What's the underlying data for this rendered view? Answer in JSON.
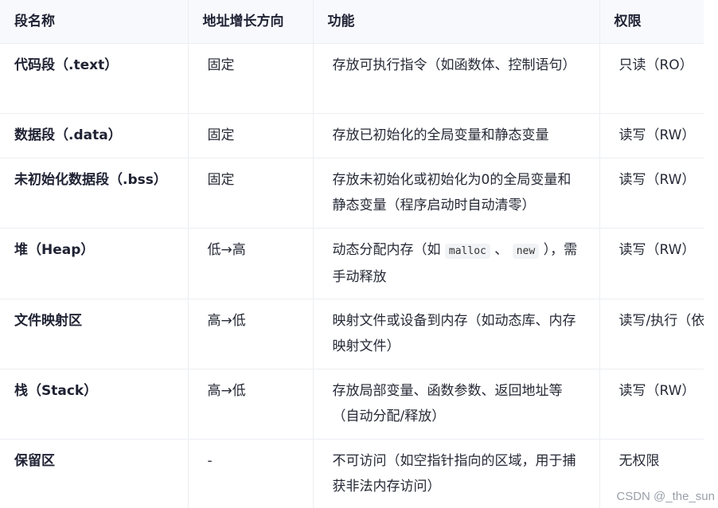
{
  "table": {
    "headers": [
      "段名称",
      "地址增长方向",
      "功能",
      "权限"
    ],
    "rows": [
      {
        "segment": "代码段（.text）",
        "direction": "固定",
        "function_text": "存放可执行指令（如函数体、控制语句）",
        "permission": "只读（RO）"
      },
      {
        "segment": "数据段（.data）",
        "direction": "固定",
        "function_text": "存放已初始化的全局变量和静态变量",
        "permission": "读写（RW）"
      },
      {
        "segment": "未初始化数据段（.bss）",
        "direction": "固定",
        "function_text": "存放未初始化或初始化为0的全局变量和静态变量（程序启动时自动清零）",
        "permission": "读写（RW）"
      },
      {
        "segment": "堆（Heap）",
        "direction": "低→高",
        "function_prefix": "动态分配内存（如 ",
        "function_code1": "malloc",
        "function_sep": " 、 ",
        "function_code2": "new",
        "function_suffix": " ），需手动释放",
        "permission": "读写（RW）"
      },
      {
        "segment": "文件映射区",
        "direction": "高→低",
        "function_text": "映射文件或设备到内存（如动态库、内存映射文件）",
        "permission": "读写/执行（依"
      },
      {
        "segment": "栈（Stack）",
        "direction": "高→低",
        "function_text": "存放局部变量、函数参数、返回地址等（自动分配/释放）",
        "permission": "读写（RW）"
      },
      {
        "segment": "保留区",
        "direction": "-",
        "function_text": "不可访问（如空指针指向的区域，用于捕获非法内存访问）",
        "permission": "无权限"
      }
    ]
  },
  "watermark": "CSDN @_the_sun"
}
